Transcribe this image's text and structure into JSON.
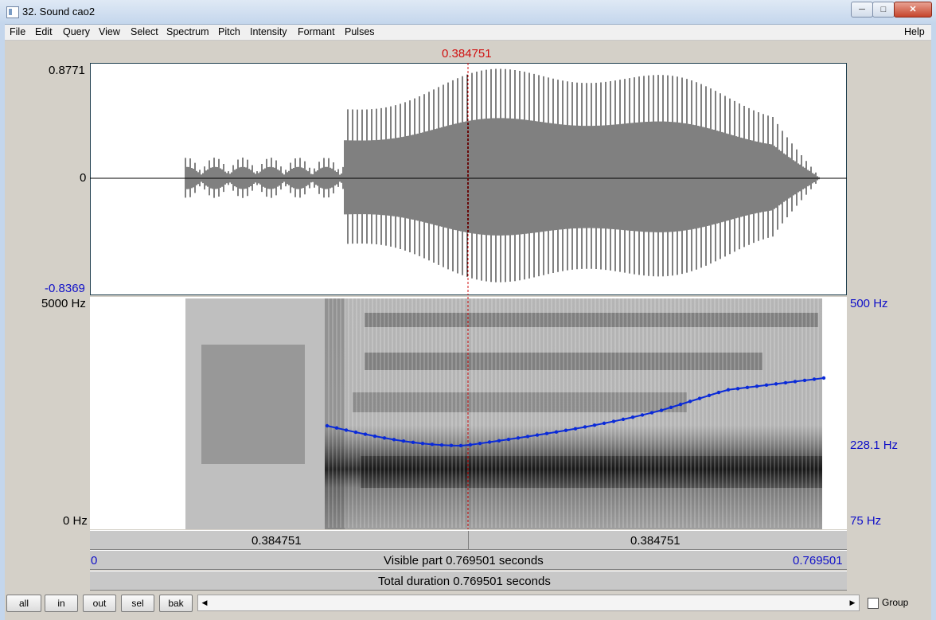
{
  "window": {
    "title": "32. Sound cao2"
  },
  "menu": {
    "left": [
      "File",
      "Edit",
      "Query",
      "View",
      "Select",
      "Spectrum",
      "Pitch",
      "Intensity",
      "Formant",
      "Pulses"
    ],
    "right": "Help"
  },
  "cursor": {
    "time_label": "0.384751"
  },
  "waveform": {
    "y_max": "0.8771",
    "y_zero": "0",
    "y_min": "-0.8369"
  },
  "spectrogram": {
    "freq_max": "5000 Hz",
    "freq_min": "0 Hz",
    "pitch_max": "500 Hz",
    "pitch_mid": "228.1 Hz",
    "pitch_min": "75 Hz"
  },
  "bars": {
    "left_segment": "0.384751",
    "right_segment": "0.384751",
    "visible_start": "0",
    "visible_label": "Visible part 0.769501 seconds",
    "visible_end": "0.769501",
    "total_label": "Total duration 0.769501 seconds"
  },
  "toolbar": {
    "buttons": [
      "all",
      "in",
      "out",
      "sel",
      "bak"
    ],
    "group_label": "Group"
  },
  "colors": {
    "pitch": "#0a2ad8",
    "cursor": "#d01010",
    "axis_blue": "#1010c8"
  }
}
